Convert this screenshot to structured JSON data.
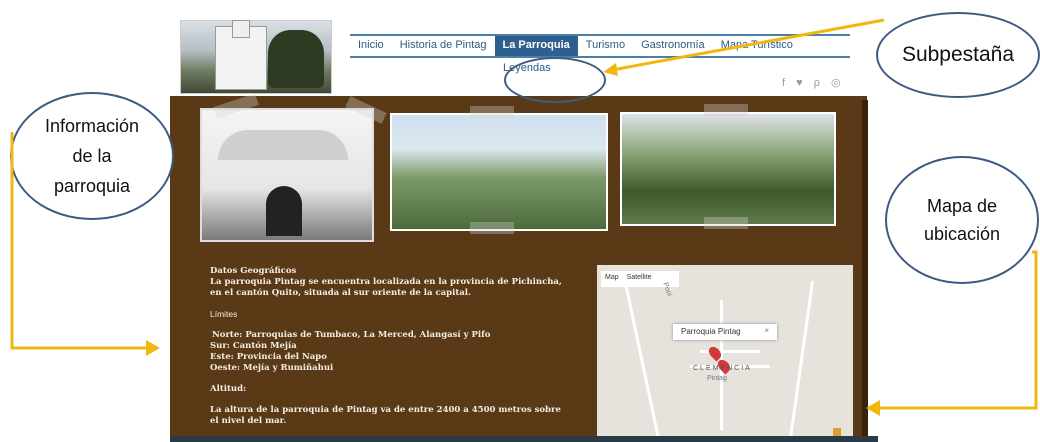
{
  "site": {
    "nav": [
      "Inicio",
      "Historia de Pintag",
      "La Parroquia",
      "Turismo",
      "Gastronomía",
      "Mapa Turístico"
    ],
    "active_nav": "La Parroquia",
    "subnav": "Leyendas",
    "social_icons": "f ♥ ρ ◎"
  },
  "content": {
    "heading1": "Datos Geográficos",
    "para1": "La parroquia Pintag se encuentra localizada en la provincia de Pichincha, en el cantón Quito, situada al sur oriente de la capital.",
    "heading2": "Límites",
    "limits": [
      "Norte: Parroquias de Tumbaco, La Merced, Alangasí y Pifo",
      "Sur: Cantón Mejía",
      "Este: Provincia del Napo",
      "Oeste: Mejía y Rumiñahui"
    ],
    "heading3": "Altitud:",
    "para3": "La altura de la parroquia de Pintag va de entre 2400 a 4500 metros sobre el nivel del mar."
  },
  "map": {
    "btn_map": "Map",
    "btn_satellite": "Satellite",
    "popup": "Parroquia Pintag",
    "popup_close": "×",
    "label_town": "CLEMENCIA",
    "label_pintag": "Pintag",
    "label_road": "Pool"
  },
  "annotations": {
    "subpestana": "Subpestaña",
    "info_line1": "Información",
    "info_line2": "de la",
    "info_line3": "parroquia",
    "mapa_line1": "Mapa de",
    "mapa_line2": "ubicación"
  },
  "colors": {
    "brown_bg": "#5a3a16",
    "nav_active": "#2e5f8e",
    "arrow": "#f1b70f",
    "bubble_border": "#3d5a80"
  }
}
